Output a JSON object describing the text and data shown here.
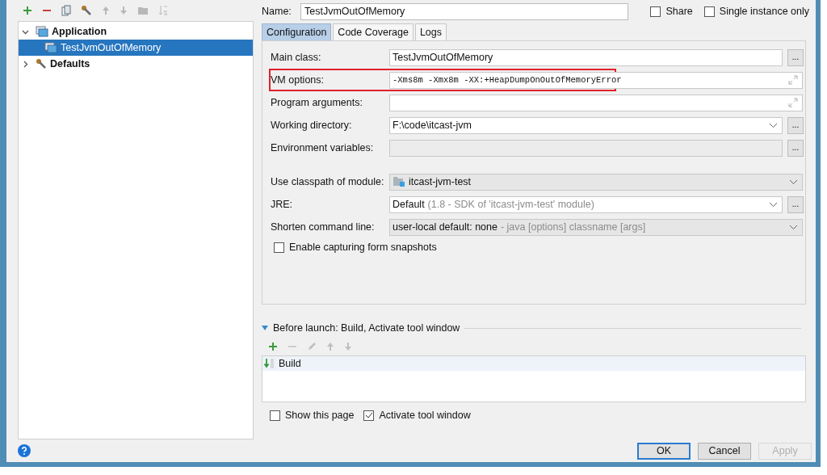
{
  "tree": [
    {
      "label": "Application",
      "kind": "app",
      "expanded": true,
      "selected": false,
      "children": [
        {
          "label": "TestJvmOutOfMemory",
          "kind": "app",
          "selected": true
        }
      ]
    },
    {
      "label": "Defaults",
      "kind": "defaults",
      "expanded": false,
      "selected": false
    }
  ],
  "name": {
    "label": "Name:",
    "value": "TestJvmOutOfMemory"
  },
  "options": [
    {
      "label": "Share",
      "checked": false
    },
    {
      "label": "Single instance only",
      "checked": false
    }
  ],
  "tabs": [
    {
      "label": "Configuration",
      "selected": true
    },
    {
      "label": "Code Coverage",
      "selected": false
    },
    {
      "label": "Logs",
      "selected": false
    }
  ],
  "fields": [
    {
      "kind": "text",
      "label": "Main class:",
      "value": "TestJvmOutOfMemory",
      "button": "...",
      "highlighted": false
    },
    {
      "kind": "expand",
      "label": "VM options:",
      "value": "-Xms8m -Xmx8m -XX:+HeapDumpOnOutOfMemoryError",
      "highlighted": true
    },
    {
      "kind": "expand",
      "label": "Program arguments:",
      "highlighted": false
    },
    {
      "kind": "combo",
      "label": "Working directory:",
      "value": "F:\\code\\itcast-jvm",
      "button": "...",
      "highlighted": false
    },
    {
      "kind": "disabled",
      "label": "Environment variables:",
      "button": "...",
      "highlighted": false
    }
  ],
  "module_fields": [
    {
      "kind": "module",
      "label": "Use classpath of module:",
      "value": "itcast-jvm-test"
    },
    {
      "kind": "combo",
      "label": "JRE:",
      "value": "Default",
      "hint": "(1.8 - SDK of 'itcast-jvm-test' module)",
      "button": "..."
    },
    {
      "kind": "select",
      "label": "Shorten command line:",
      "value": "user-local default: none",
      "hint": "- java [options] classname [args]"
    }
  ],
  "snapshot": {
    "label": "Enable capturing form snapshots",
    "checked": false
  },
  "before_launch": {
    "title": "Before launch: Build, Activate tool window",
    "expanded": true,
    "items": [
      {
        "label": "Build",
        "selected": true
      }
    ]
  },
  "after_checks": [
    {
      "label": "Show this page",
      "checked": false
    },
    {
      "label": "Activate tool window",
      "checked": true
    }
  ],
  "buttons": [
    {
      "label": "OK",
      "default": true,
      "disabled": false
    },
    {
      "label": "Cancel",
      "default": false,
      "disabled": false
    },
    {
      "label": "Apply",
      "default": false,
      "disabled": true
    }
  ]
}
